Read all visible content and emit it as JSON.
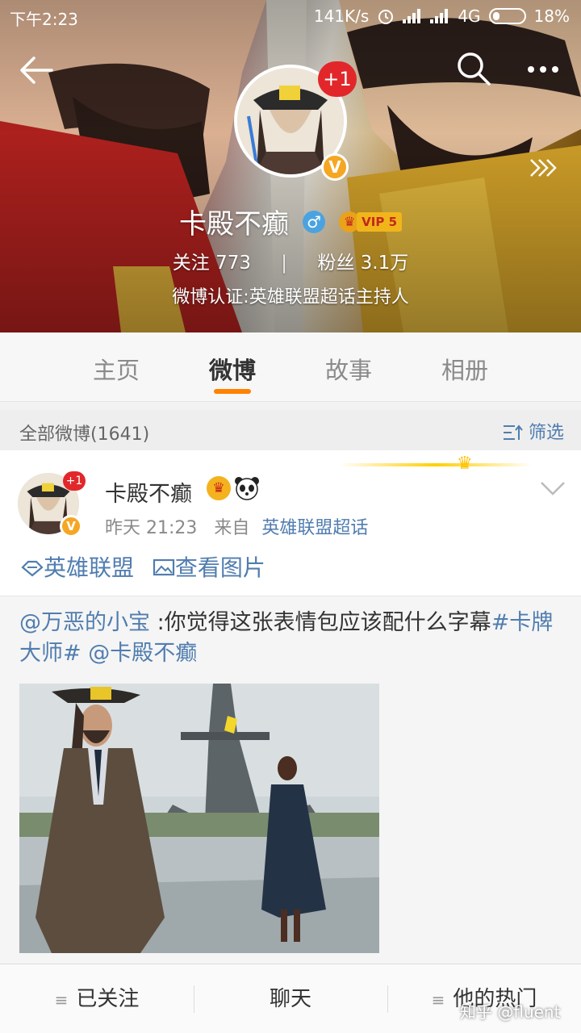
{
  "status_bar": {
    "time": "下午2:23",
    "speed": "141K/s",
    "network": "4G",
    "battery": "18%"
  },
  "profile": {
    "avatar_badge": "+1",
    "verified_mark": "V",
    "name": "卡殿不癫",
    "gender_symbol": "♂",
    "vip_level": "VIP 5",
    "following_label": "关注",
    "following_count": "773",
    "stats_separator": "|",
    "followers_label": "粉丝",
    "followers_count": "3.1万",
    "verification": "微博认证:英雄联盟超话主持人"
  },
  "tabs": [
    "主页",
    "微博",
    "故事",
    "相册"
  ],
  "active_tab": "微博",
  "feed": {
    "count_label": "全部微博(1641)",
    "filter_label": "筛选"
  },
  "post": {
    "author": "卡殿不癫",
    "avatar_badge": "+1",
    "verified_mark": "V",
    "time": "昨天 21:23",
    "from_label": "来自",
    "source": "英雄联盟超话",
    "tags": [
      "英雄联盟",
      "查看图片"
    ],
    "text": {
      "mention1": "@万恶的小宝",
      "body": " :你觉得这张表情包应该配什么字幕",
      "hashtag": "#卡牌大师#",
      "mention2": "@卡殿不癫"
    }
  },
  "bottom_bar": {
    "follow_label": "已关注",
    "chat_label": "聊天",
    "hot_label": "他的热门"
  },
  "watermark": "知乎 @fluent",
  "colors": {
    "accent_orange": "#ff8200",
    "link_blue": "#507daf",
    "badge_red": "#e2272b",
    "verified_gold": "#f5a623"
  }
}
